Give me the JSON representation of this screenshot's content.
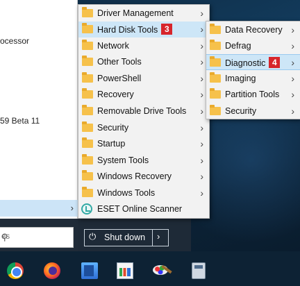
{
  "start_menu": {
    "entries": [
      "ocessor",
      "59 Beta 11"
    ],
    "search_placeholder": "es",
    "shutdown_label": "Shut down"
  },
  "menu1": {
    "items": [
      {
        "label": "Driver Management",
        "badge": "",
        "arrow": true
      },
      {
        "label": "Hard Disk Tools",
        "badge": "3",
        "arrow": true
      },
      {
        "label": "Network",
        "badge": "",
        "arrow": true
      },
      {
        "label": "Other Tools",
        "badge": "",
        "arrow": true
      },
      {
        "label": "PowerShell",
        "badge": "",
        "arrow": true
      },
      {
        "label": "Recovery",
        "badge": "",
        "arrow": true
      },
      {
        "label": "Removable Drive Tools",
        "badge": "",
        "arrow": true
      },
      {
        "label": "Security",
        "badge": "",
        "arrow": true
      },
      {
        "label": "Startup",
        "badge": "",
        "arrow": true
      },
      {
        "label": "System Tools",
        "badge": "",
        "arrow": true
      },
      {
        "label": "Windows Recovery",
        "badge": "",
        "arrow": true
      },
      {
        "label": "Windows Tools",
        "badge": "",
        "arrow": true
      },
      {
        "label": "ESET Online Scanner",
        "badge": "",
        "arrow": false
      }
    ]
  },
  "menu2": {
    "items": [
      {
        "label": "Data Recovery",
        "badge": ""
      },
      {
        "label": "Defrag",
        "badge": ""
      },
      {
        "label": "Diagnostic",
        "badge": "4"
      },
      {
        "label": "Imaging",
        "badge": ""
      },
      {
        "label": "Partition Tools",
        "badge": ""
      },
      {
        "label": "Security",
        "badge": ""
      }
    ]
  },
  "taskbar": {
    "apps": [
      "chrome-icon",
      "firefox-icon",
      "notes-icon",
      "chart-app-icon",
      "paint-icon",
      "calculator-icon"
    ]
  }
}
